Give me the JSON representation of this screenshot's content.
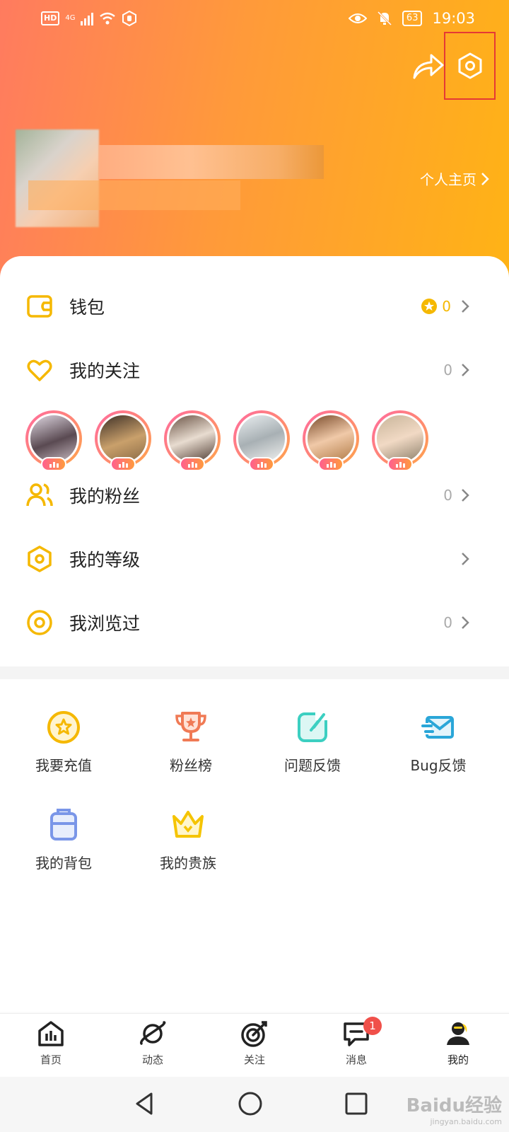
{
  "status_bar": {
    "hd": "HD",
    "network": "4G",
    "battery": "63",
    "time": "19:03"
  },
  "header": {
    "profile_link": "个人主页"
  },
  "menu": {
    "wallet": {
      "label": "钱包",
      "value": "0"
    },
    "following": {
      "label": "我的关注",
      "value": "0"
    },
    "fans": {
      "label": "我的粉丝",
      "value": "0"
    },
    "level": {
      "label": "我的等级"
    },
    "history": {
      "label": "我浏览过",
      "value": "0"
    }
  },
  "following_avatars_count": 6,
  "tools": [
    {
      "label": "我要充值",
      "icon": "recharge-icon"
    },
    {
      "label": "粉丝榜",
      "icon": "trophy-icon"
    },
    {
      "label": "问题反馈",
      "icon": "feedback-icon"
    },
    {
      "label": "Bug反馈",
      "icon": "bug-report-icon"
    },
    {
      "label": "我的背包",
      "icon": "backpack-icon"
    },
    {
      "label": "我的贵族",
      "icon": "crown-icon"
    }
  ],
  "tabs": [
    {
      "label": "首页"
    },
    {
      "label": "动态"
    },
    {
      "label": "关注"
    },
    {
      "label": "消息",
      "badge": "1"
    },
    {
      "label": "我的"
    }
  ],
  "watermark": {
    "brand": "Baidu经验",
    "url": "jingyan.baidu.com"
  },
  "colors": {
    "accent": "#f5b800",
    "header_start": "#ff7b5f",
    "header_end": "#ffb315",
    "badge": "#f0504a"
  }
}
